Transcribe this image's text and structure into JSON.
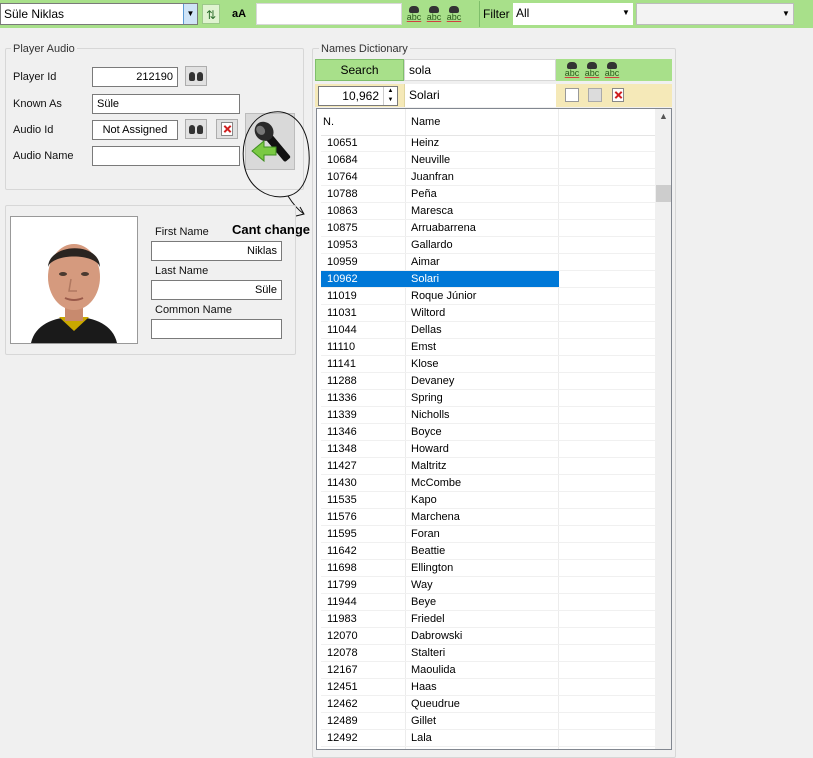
{
  "toolbar": {
    "player_selector": "Süle Niklas",
    "case_button": "aA",
    "filter_label": "Filter",
    "filter_value": "All"
  },
  "player_audio": {
    "title": "Player Audio",
    "player_id_label": "Player Id",
    "player_id": "212190",
    "known_as_label": "Known As",
    "known_as": "Süle",
    "audio_id_label": "Audio Id",
    "audio_id": "Not Assigned",
    "audio_name_label": "Audio Name",
    "audio_name": ""
  },
  "player_card": {
    "first_name_label": "First Name",
    "first_name": "Niklas",
    "last_name_label": "Last Name",
    "last_name": "Süle",
    "common_name_label": "Common Name",
    "common_name": ""
  },
  "annotation": "Cant change",
  "names_dictionary": {
    "title": "Names Dictionary",
    "search_button": "Search",
    "search_value": "sola",
    "selected_number": "10,962",
    "selected_name": "Solari",
    "columns": [
      "N.",
      "Name"
    ],
    "rows": [
      [
        "10651",
        "Heinz"
      ],
      [
        "10684",
        "Neuville"
      ],
      [
        "10764",
        "Juanfran"
      ],
      [
        "10788",
        "Peña"
      ],
      [
        "10863",
        "Maresca"
      ],
      [
        "10875",
        "Arruabarrena"
      ],
      [
        "10953",
        "Gallardo"
      ],
      [
        "10959",
        "Aimar"
      ],
      [
        "10962",
        "Solari"
      ],
      [
        "11019",
        "Roque Júnior"
      ],
      [
        "11031",
        "Wiltord"
      ],
      [
        "11044",
        "Dellas"
      ],
      [
        "11110",
        "Emst"
      ],
      [
        "11141",
        "Klose"
      ],
      [
        "11288",
        "Devaney"
      ],
      [
        "11336",
        "Spring"
      ],
      [
        "11339",
        "Nicholls"
      ],
      [
        "11346",
        "Boyce"
      ],
      [
        "11348",
        "Howard"
      ],
      [
        "11427",
        "Maltritz"
      ],
      [
        "11430",
        "McCombe"
      ],
      [
        "11535",
        "Kapo"
      ],
      [
        "11576",
        "Marchena"
      ],
      [
        "11595",
        "Foran"
      ],
      [
        "11642",
        "Beattie"
      ],
      [
        "11698",
        "Ellington"
      ],
      [
        "11799",
        "Way"
      ],
      [
        "11944",
        "Beye"
      ],
      [
        "11983",
        "Friedel"
      ],
      [
        "12070",
        "Dabrowski"
      ],
      [
        "12078",
        "Stalteri"
      ],
      [
        "12167",
        "Maoulida"
      ],
      [
        "12451",
        "Haas"
      ],
      [
        "12462",
        "Queudrue"
      ],
      [
        "12489",
        "Gillet"
      ],
      [
        "12492",
        "Lala"
      ]
    ],
    "selected_index": 8
  },
  "colors": {
    "toolbar_green": "#a8e08a",
    "selection_blue": "#0078d7"
  }
}
